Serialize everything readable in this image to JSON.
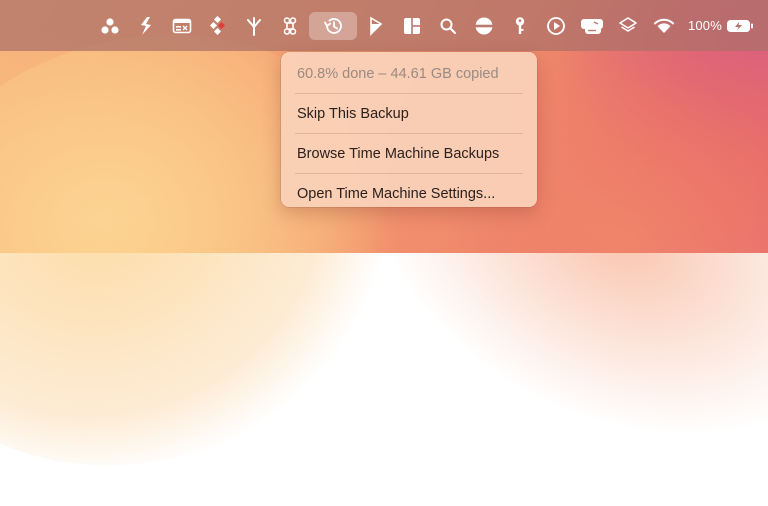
{
  "menubar": {
    "icons": [
      {
        "name": "three-dots-cluster-icon"
      },
      {
        "name": "fork-app-icon"
      },
      {
        "name": "window-card-icon"
      },
      {
        "name": "diamond-pattern-icon"
      },
      {
        "name": "branch-icon"
      },
      {
        "name": "command-icon"
      },
      {
        "name": "time-machine-icon"
      },
      {
        "name": "arrow-flag-icon"
      },
      {
        "name": "window-layout-icon"
      },
      {
        "name": "search-icon"
      },
      {
        "name": "disc-icon"
      },
      {
        "name": "key-icon"
      },
      {
        "name": "play-circle-icon"
      },
      {
        "name": "display-switch-icon"
      },
      {
        "name": "stack-layers-icon"
      },
      {
        "name": "wifi-icon"
      },
      {
        "name": "battery-charging-icon"
      }
    ],
    "battery_percent": "100%"
  },
  "time_machine_menu": {
    "status": "60.8% done – 44.61 GB copied",
    "skip_backup": "Skip This Backup",
    "browse_backups": "Browse Time Machine Backups",
    "open_settings": "Open Time Machine Settings..."
  }
}
